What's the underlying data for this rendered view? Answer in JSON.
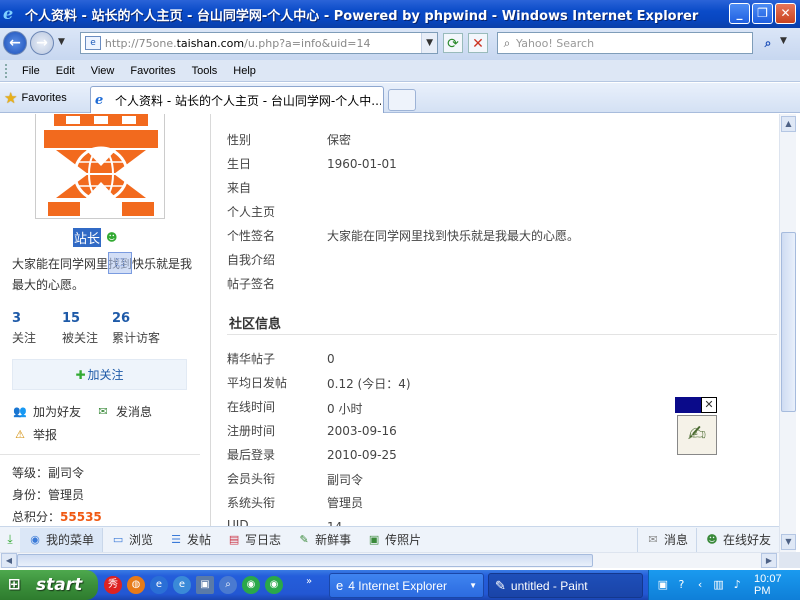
{
  "window": {
    "title": "个人资料 - 站长的个人主页 - 台山同学网-个人中心 - Powered by phpwind - Windows Internet Explorer"
  },
  "addressbar": {
    "url_prefix": "http://75one.",
    "url_domain": "taishan.com",
    "url_path": "/u.php?a=info&uid=14",
    "search_placeholder": "Yahoo! Search"
  },
  "menu": {
    "items": [
      "File",
      "Edit",
      "View",
      "Favorites",
      "Tools",
      "Help"
    ]
  },
  "favbar": {
    "favorites_label": "Favorites",
    "tab_title": "个人资料 - 站长的个人主页 - 台山同学网-个人中..."
  },
  "profile": {
    "username": "站长",
    "signature": "大家能在同学网里找到快乐就是我最大的心愿。",
    "stats": [
      {
        "num": "3",
        "label": "关注"
      },
      {
        "num": "15",
        "label": "被关注"
      },
      {
        "num": "26",
        "label": "累计访客"
      }
    ],
    "follow_label": "加关注",
    "actions": {
      "add_friend": "加为好友",
      "send_message": "发消息",
      "report": "举报"
    },
    "level_label": "等级：",
    "level_value": "副司令",
    "identity_label": "身份：",
    "identity_value": "管理员",
    "points_label": "总积分：",
    "points_value": "55535"
  },
  "details": {
    "gender_label": "性别",
    "gender_value": "保密",
    "birthday_label": "生日",
    "birthday_value": "1960-01-01",
    "from_label": "来自",
    "homepage_label": "个人主页",
    "signature_label": "个性签名",
    "signature_value": "大家能在同学网里找到快乐就是我最大的心愿。",
    "intro_label": "自我介绍",
    "post_sig_label": "帖子签名"
  },
  "community": {
    "title": "社区信息",
    "digest_label": "精华帖子",
    "digest_value": "0",
    "daily_label": "平均日发帖",
    "daily_value": "0.12 (今日：4)",
    "online_label": "在线时间",
    "online_value": "0 小时",
    "reg_label": "注册时间",
    "reg_value": "2003-09-16",
    "last_label": "最后登录",
    "last_value": "2010-09-25",
    "member_title_label": "会员头衔",
    "member_title_value": "副司令",
    "system_title_label": "系统头衔",
    "system_title_value": "管理员",
    "uid_label": "UID",
    "uid_value": "14"
  },
  "bottombar": {
    "my_menu": "我的菜单",
    "browse": "浏览",
    "post": "发帖",
    "diary": "写日志",
    "fresh": "新鲜事",
    "photos": "传照片",
    "messages": "消息",
    "online_friends": "在线好友"
  },
  "taskbar": {
    "start": "start",
    "ie_task": "4 Internet Explorer",
    "paint_task": "untitled - Paint",
    "clock": "10:07 PM"
  },
  "colors": {
    "accent_blue": "#1e5aa8",
    "points_orange": "#f05a14",
    "titlebar_blue": "#0a4bc8"
  }
}
